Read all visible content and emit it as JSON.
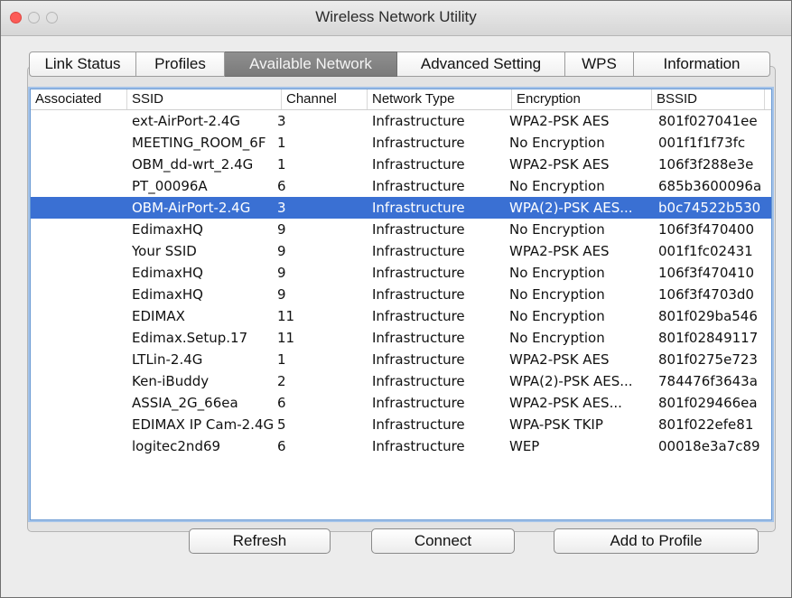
{
  "window": {
    "title": "Wireless Network Utility"
  },
  "tabs": [
    {
      "label": "Link Status",
      "active": false
    },
    {
      "label": "Profiles",
      "active": false
    },
    {
      "label": "Available Network",
      "active": true
    },
    {
      "label": "Advanced Setting",
      "active": false
    },
    {
      "label": "WPS",
      "active": false
    },
    {
      "label": "Information",
      "active": false
    }
  ],
  "table": {
    "columns": [
      "Associated",
      "SSID",
      "Channel",
      "Network Type",
      "Encryption",
      "BSSID"
    ],
    "selected_index": 4,
    "rows": [
      [
        "",
        "ext-AirPort-2.4G",
        "3",
        "Infrastructure",
        "WPA2-PSK AES",
        "801f027041ee"
      ],
      [
        "",
        "MEETING_ROOM_6F",
        "1",
        "Infrastructure",
        "No Encryption",
        "001f1f1f73fc"
      ],
      [
        "",
        "OBM_dd-wrt_2.4G",
        "1",
        "Infrastructure",
        "WPA2-PSK AES",
        "106f3f288e3e"
      ],
      [
        "",
        "PT_00096A",
        "6",
        "Infrastructure",
        "No Encryption",
        "685b3600096a"
      ],
      [
        "",
        "OBM-AirPort-2.4G",
        "3",
        "Infrastructure",
        "WPA(2)-PSK AES...",
        "b0c74522b530"
      ],
      [
        "",
        "EdimaxHQ",
        "9",
        "Infrastructure",
        "No Encryption",
        "106f3f470400"
      ],
      [
        "",
        "Your SSID",
        "9",
        "Infrastructure",
        "WPA2-PSK AES",
        "001f1fc02431"
      ],
      [
        "",
        "EdimaxHQ",
        "9",
        "Infrastructure",
        "No Encryption",
        "106f3f470410"
      ],
      [
        "",
        "EdimaxHQ",
        "9",
        "Infrastructure",
        "No Encryption",
        "106f3f4703d0"
      ],
      [
        "",
        "EDIMAX",
        "11",
        "Infrastructure",
        "No Encryption",
        "801f029ba546"
      ],
      [
        "",
        "Edimax.Setup.17",
        "11",
        "Infrastructure",
        "No Encryption",
        "801f02849117"
      ],
      [
        "",
        "LTLin-2.4G",
        "1",
        "Infrastructure",
        "WPA2-PSK AES",
        "801f0275e723"
      ],
      [
        "",
        "Ken-iBuddy",
        "2",
        "Infrastructure",
        "WPA(2)-PSK AES...",
        "784476f3643a"
      ],
      [
        "",
        "ASSIA_2G_66ea",
        "6",
        "Infrastructure",
        "WPA2-PSK AES...",
        "801f029466ea"
      ],
      [
        "",
        "EDIMAX IP Cam-2.4G",
        "5",
        "Infrastructure",
        "WPA-PSK TKIP",
        "801f022efe81"
      ],
      [
        "",
        "logitec2nd69",
        "6",
        "Infrastructure",
        "WEP",
        "00018e3a7c89"
      ]
    ]
  },
  "buttons": {
    "refresh": "Refresh",
    "connect": "Connect",
    "add_to_profile": "Add to Profile"
  },
  "colors": {
    "selection": "#3a70d3",
    "active_tab": "#838383"
  }
}
